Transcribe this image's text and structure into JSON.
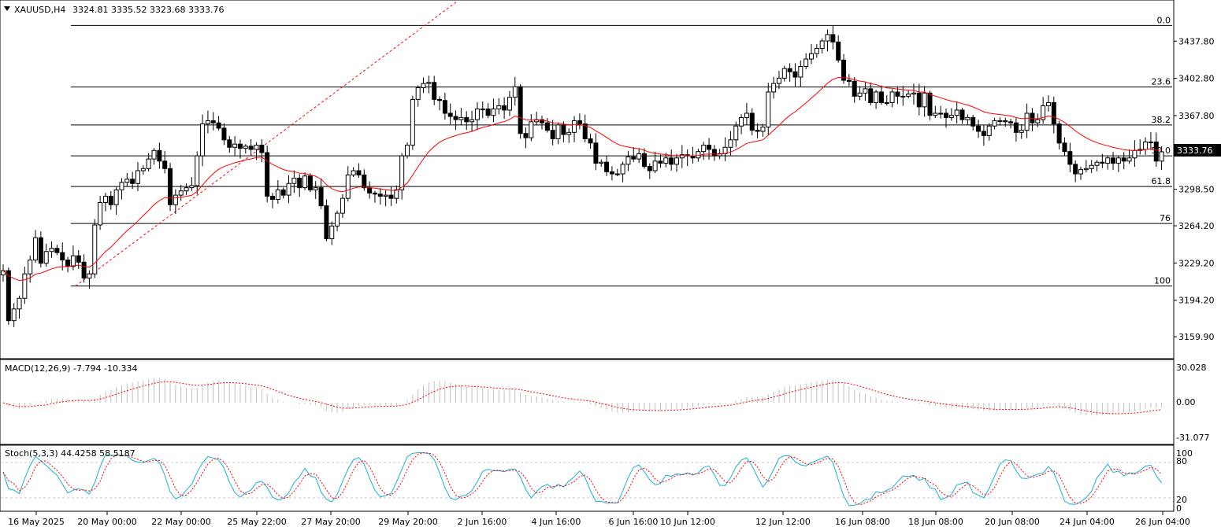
{
  "header": {
    "symbol": "XAUUSD,H4",
    "ohlc": "3324.81 3335.52 3323.68 3333.76"
  },
  "current_price_label": "3333.76",
  "macd": {
    "label": "MACD(12,26,9) -7.794 -10.334",
    "ticks": [
      "30.028",
      "0.00",
      "-31.077"
    ]
  },
  "stoch": {
    "label": "Stoch(5,3,3) 44.4258 58.5187",
    "ticks": [
      "100",
      "80",
      "20",
      "0"
    ]
  },
  "x_axis_labels": [
    "16 May 2025",
    "20 May 00:00",
    "22 May 00:00",
    "25 May 22:00",
    "27 May 20:00",
    "29 May 20:00",
    "2 Jun 16:00",
    "4 Jun 16:00",
    "6 Jun 16:00",
    "10 Jun 12:00",
    "12 Jun 12:00",
    "16 Jun 08:00",
    "18 Jun 08:00",
    "20 Jun 08:00",
    "24 Jun 04:00",
    "26 Jun 04:00"
  ],
  "colors": {
    "ma": "#ff0000",
    "signal": "#ff0000",
    "stoch_main": "#1ab0d8",
    "grid": "#c8c8c8",
    "hist": "#c0c0c0"
  },
  "chart_data": [
    {
      "type": "candlestick",
      "title": "XAUUSD,H4",
      "ylim": [
        3140,
        3475
      ],
      "y_ticks": [
        3437.8,
        3402.8,
        3367.8,
        3333.76,
        3298.5,
        3264.2,
        3229.2,
        3194.2,
        3159.9
      ],
      "fib_levels": [
        {
          "label": "0.0",
          "value": 3452.5
        },
        {
          "label": "23.6",
          "value": 3394.7
        },
        {
          "label": "38.2",
          "value": 3359.0
        },
        {
          "label": "50.0",
          "value": 3330.0
        },
        {
          "label": "61.8",
          "value": 3301.1
        },
        {
          "label": "76",
          "value": 3266.4
        },
        {
          "label": "100",
          "value": 3207.6
        }
      ],
      "trendline": [
        [
          3207.6,
          0
        ],
        [
          3452.5,
          1
        ]
      ],
      "close": [
        3222,
        3175,
        3186,
        3196,
        3219,
        3232,
        3253,
        3229,
        3240,
        3243,
        3239,
        3232,
        3226,
        3236,
        3230,
        3215,
        3219,
        3265,
        3286,
        3292,
        3284,
        3298,
        3305,
        3308,
        3304,
        3316,
        3318,
        3327,
        3335,
        3325,
        3318,
        3284,
        3293,
        3297,
        3300,
        3302,
        3330,
        3360,
        3363,
        3361,
        3356,
        3345,
        3338,
        3341,
        3337,
        3339,
        3336,
        3340,
        3333,
        3292,
        3289,
        3298,
        3293,
        3304,
        3309,
        3300,
        3311,
        3298,
        3300,
        3283,
        3252,
        3264,
        3276,
        3290,
        3312,
        3316,
        3312,
        3300,
        3295,
        3294,
        3292,
        3293,
        3290,
        3298,
        3330,
        3340,
        3383,
        3394,
        3398,
        3399,
        3383,
        3382,
        3370,
        3367,
        3364,
        3366,
        3362,
        3364,
        3374,
        3374,
        3368,
        3374,
        3377,
        3373,
        3385,
        3395,
        3351,
        3347,
        3362,
        3364,
        3361,
        3354,
        3346,
        3359,
        3350,
        3352,
        3363,
        3360,
        3346,
        3342,
        3323,
        3324,
        3315,
        3313,
        3313,
        3322,
        3329,
        3327,
        3332,
        3320,
        3316,
        3325,
        3323,
        3328,
        3322,
        3328,
        3331,
        3330,
        3328,
        3334,
        3340,
        3336,
        3330,
        3332,
        3338,
        3345,
        3358,
        3366,
        3370,
        3354,
        3353,
        3357,
        3390,
        3398,
        3403,
        3412,
        3409,
        3404,
        3414,
        3421,
        3426,
        3431,
        3438,
        3444,
        3437,
        3420,
        3401,
        3400,
        3386,
        3389,
        3393,
        3380,
        3390,
        3380,
        3380,
        3390,
        3386,
        3386,
        3388,
        3389,
        3376,
        3389,
        3368,
        3370,
        3370,
        3366,
        3368,
        3373,
        3364,
        3366,
        3358,
        3353,
        3349,
        3358,
        3363,
        3363,
        3362,
        3361,
        3352,
        3354,
        3370,
        3361,
        3364,
        3377,
        3380,
        3360,
        3342,
        3334,
        3322,
        3313,
        3317,
        3318,
        3321,
        3324,
        3323,
        3328,
        3323,
        3328,
        3325,
        3328,
        3335,
        3336,
        3343,
        3343,
        3325,
        3333.76
      ],
      "ma_period": 20
    },
    {
      "type": "bar",
      "title": "MACD(12,26,9)",
      "ylim": [
        -42,
        42
      ],
      "ticks": [
        30.028,
        0,
        -31.077
      ],
      "note": "histogram = MACD main line, dashed line = signal"
    },
    {
      "type": "line",
      "title": "Stoch(5,3,3)",
      "ylim": [
        0,
        100
      ],
      "levels": [
        80,
        20
      ]
    }
  ]
}
